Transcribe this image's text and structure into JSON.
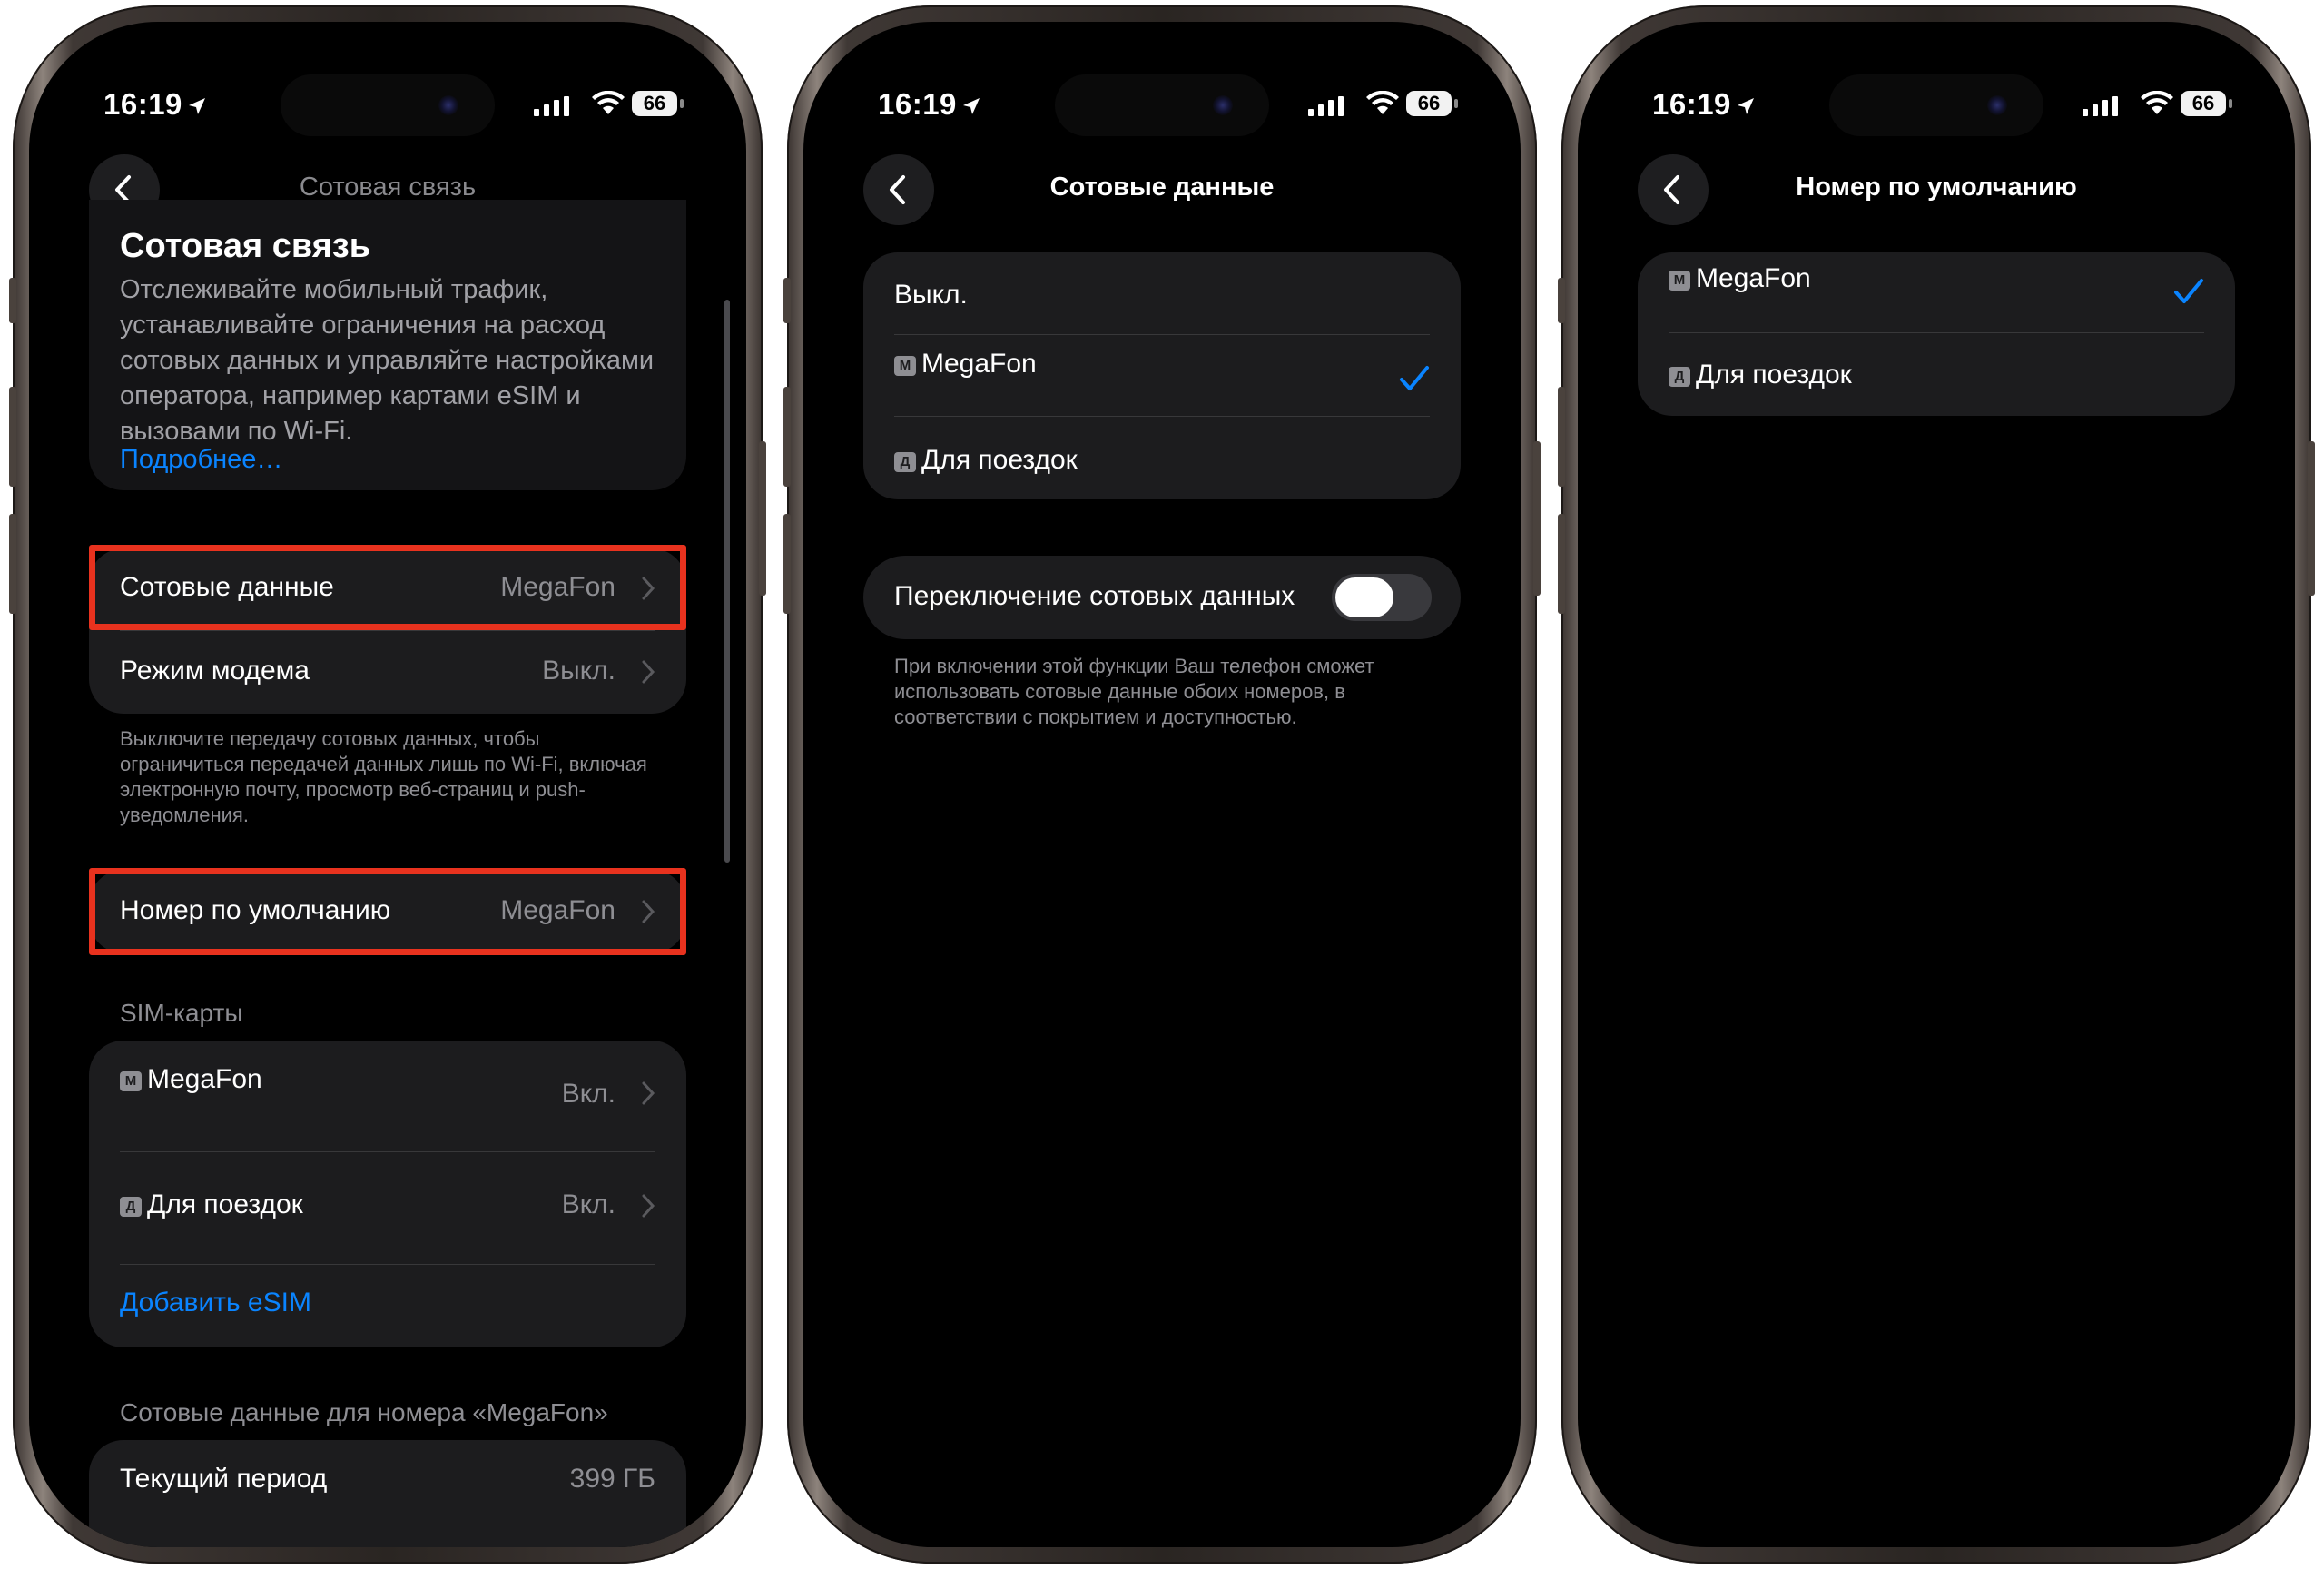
{
  "status": {
    "time": "16:19",
    "battery": "66"
  },
  "screen1": {
    "nav_title": "Сотовая связь",
    "header": {
      "title": "Сотовая связь",
      "description": "Отслеживайте мобильный трафик, устанавливайте ограничения на расход сотовых данных и управляйте настройками оператора, например картами eSIM и вызовами по Wi-Fi.",
      "more_link": "Подробнее…"
    },
    "cellular_data": {
      "label": "Сотовые данные",
      "value": "MegaFon"
    },
    "hotspot": {
      "label": "Режим модема",
      "value": "Выкл."
    },
    "footer_note": "Выключите передачу сотовых данных, чтобы ограничиться передачей данных лишь по Wi-Fi, включая электронную почту, просмотр веб-страниц и push-уведомления.",
    "default_number": {
      "label": "Номер по умолчанию",
      "value": "MegaFon"
    },
    "sim_section_header": "SIM-карты",
    "sims": [
      {
        "tag": "M",
        "name": "MegaFon",
        "value": "Вкл."
      },
      {
        "tag": "Д",
        "name": "Для поездок",
        "value": "Вкл."
      }
    ],
    "add_esim": "Добавить eSIM",
    "usage_header": "Сотовые данные для номера «MegaFon»",
    "current_period": {
      "label": "Текущий период",
      "value": "399 ГБ"
    }
  },
  "screen2": {
    "nav_title": "Сотовые данные",
    "options": [
      {
        "label": "Выкл."
      },
      {
        "tag": "M",
        "label": "MegaFon",
        "selected": true
      },
      {
        "tag": "Д",
        "label": "Для поездок"
      }
    ],
    "switching": {
      "label": "Переключение сотовых данных",
      "enabled": false
    },
    "switching_note": "При включении этой функции Ваш телефон сможет использовать сотовые данные обоих номеров, в соответствии с покрытием и доступностью."
  },
  "screen3": {
    "nav_title": "Номер по умолчанию",
    "options": [
      {
        "tag": "M",
        "label": "MegaFon",
        "selected": true
      },
      {
        "tag": "Д",
        "label": "Для поездок"
      }
    ]
  },
  "colors": {
    "accent": "#0a84ff",
    "highlight": "#e8321e",
    "cell_bg": "#1c1c1e",
    "secondary_text": "#8e8e93"
  }
}
